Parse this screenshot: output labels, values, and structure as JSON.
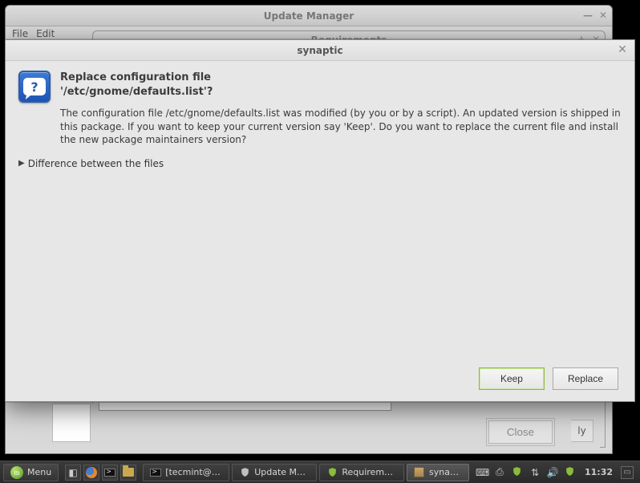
{
  "update_manager": {
    "title": "Update Manager",
    "menu": {
      "file": "File",
      "edit": "Edit"
    }
  },
  "requirements": {
    "title": "Requirements",
    "close_label": "Close",
    "trailing_text": "ly"
  },
  "dialog": {
    "title": "synaptic",
    "heading_line1": "Replace configuration file",
    "heading_line2": "'/etc/gnome/defaults.list'?",
    "body": "The configuration file /etc/gnome/defaults.list was modified (by you or by a script). An updated version is shipped in this package. If you want to keep your current version say 'Keep'. Do you want to replace the current file and install the new package maintainers version?",
    "expander_label": "Difference between the files",
    "buttons": {
      "keep": "Keep",
      "replace": "Replace"
    }
  },
  "taskbar": {
    "menu_label": "Menu",
    "tasks": [
      {
        "label": "[tecmint@te...",
        "icon": "terminal",
        "active": false
      },
      {
        "label": "Update Man...",
        "icon": "shield",
        "active": false
      },
      {
        "label": "Requirements",
        "icon": "shield",
        "active": false
      },
      {
        "label": "synaptic",
        "icon": "box",
        "active": true
      }
    ],
    "clock": "11:32"
  },
  "icons": {
    "question_mark": "?"
  }
}
